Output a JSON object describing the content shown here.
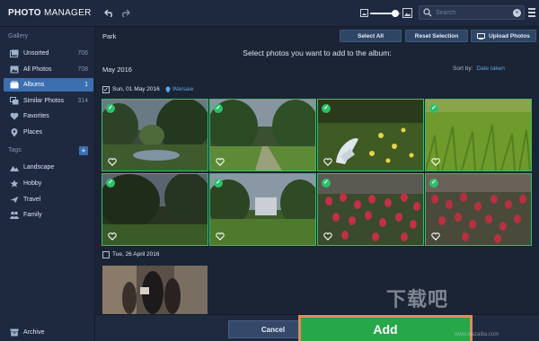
{
  "app": {
    "title_bold": "PHOTO",
    "title_rest": " MANAGER"
  },
  "toolbar": {
    "undo_icon": "undo-icon",
    "redo_icon": "redo-icon",
    "zoom_level": 0.82
  },
  "search": {
    "placeholder": "Search",
    "clear_label": "×"
  },
  "sidebar": {
    "gallery_label": "Gallery",
    "items": [
      {
        "label": "Unsorted",
        "count": "706",
        "icon": "unsorted-icon",
        "active": false
      },
      {
        "label": "All Photos",
        "count": "708",
        "icon": "all-photos-icon",
        "active": false
      },
      {
        "label": "Albums",
        "count": "1",
        "icon": "albums-icon",
        "active": true
      },
      {
        "label": "Similar Photos",
        "count": "314",
        "icon": "similar-photos-icon",
        "active": false
      },
      {
        "label": "Favorites",
        "count": "",
        "icon": "heart-icon",
        "active": false
      },
      {
        "label": "Places",
        "count": "",
        "icon": "location-icon",
        "active": false
      }
    ],
    "tags_label": "Tags",
    "add_tag_label": "+",
    "tags": [
      {
        "label": "Landscape",
        "icon": "landscape-icon"
      },
      {
        "label": "Hobby",
        "icon": "hobby-icon"
      },
      {
        "label": "Travel",
        "icon": "travel-icon"
      },
      {
        "label": "Family",
        "icon": "family-icon"
      }
    ],
    "archive_label": "Archive"
  },
  "main": {
    "album_name": "Park",
    "select_all": "Select All",
    "reset_selection": "Reset Selection",
    "upload_photos": "Upload Photos",
    "instruction": "Select photos you want to add to the album:",
    "month": "May 2016",
    "sort_label": "Sort by:",
    "sort_value": "Date taken",
    "groups": [
      {
        "date": "Sun, 01 May 2016",
        "location": "Warsaw",
        "checked": true,
        "check_mark": "✓"
      },
      {
        "date": "Tue, 26 April 2016",
        "location": "",
        "checked": false,
        "check_mark": ""
      }
    ],
    "photos": [
      {
        "scene": "park-trees-pond",
        "selected": true
      },
      {
        "scene": "park-trees-path",
        "selected": true
      },
      {
        "scene": "flowers-grass",
        "selected": true
      },
      {
        "scene": "green-grass",
        "selected": true
      },
      {
        "scene": "dark-trees",
        "selected": true
      },
      {
        "scene": "building-trees",
        "selected": true
      },
      {
        "scene": "red-tulips",
        "selected": true
      },
      {
        "scene": "red-tulips-2",
        "selected": true
      },
      {
        "scene": "street-people",
        "selected": false
      }
    ],
    "check_symbol": "✓"
  },
  "footer": {
    "cancel": "Cancel",
    "add": "Add"
  },
  "watermark": {
    "text": "下载吧",
    "url": "www.xiazaiba.com"
  }
}
